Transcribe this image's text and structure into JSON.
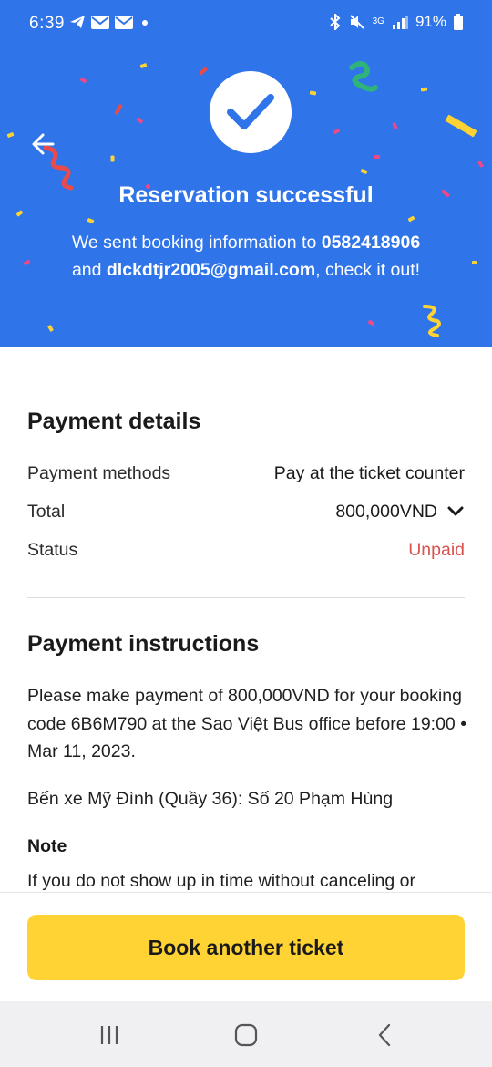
{
  "status_bar": {
    "time": "6:39",
    "network": "3G",
    "battery": "91%"
  },
  "colors": {
    "hero_bg": "#2f74e8",
    "button_bg": "#ffd333",
    "unpaid": "#d9534f"
  },
  "hero": {
    "title": "Reservation successful",
    "line1_prefix": "We sent booking information to ",
    "phone": "0582418906",
    "line2_prefix": "and ",
    "email": "dlckdtjr2005@gmail.com",
    "line2_suffix": ", check it out!"
  },
  "payment_details": {
    "title": "Payment details",
    "rows": [
      {
        "label": "Payment methods",
        "value": "Pay at the ticket counter"
      },
      {
        "label": "Total",
        "value": "800,000VND"
      },
      {
        "label": "Status",
        "value": "Unpaid"
      }
    ]
  },
  "payment_instructions": {
    "title": "Payment instructions",
    "text": "Please make payment of 800,000VND for your booking code 6B6M790 at the Sao Việt Bus office before 19:00 • Mar 11, 2023.",
    "location": "Bến xe Mỹ Đình (Quầy 36): Số 20 Phạm Hùng",
    "note_title": "Note",
    "note_text": "If you do not show up in time without canceling or"
  },
  "cta": {
    "label": "Book another ticket"
  },
  "icons": [
    "back-arrow-icon",
    "checkmark-icon",
    "chevron-down-icon",
    "recent-apps-icon",
    "home-icon",
    "back-icon"
  ]
}
